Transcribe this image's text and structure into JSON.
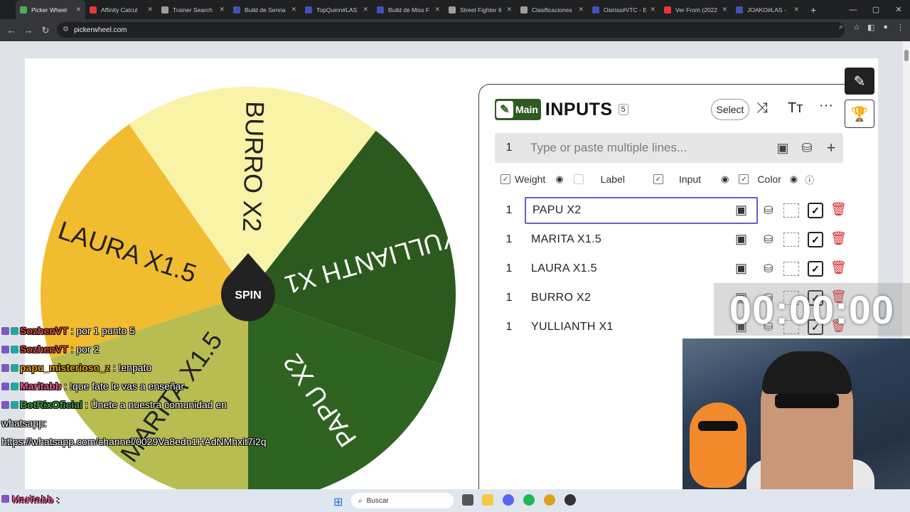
{
  "browser": {
    "tabs": [
      {
        "label": "Picker Wheel",
        "active": true,
        "color": "#4caf50"
      },
      {
        "label": "Affinity Calcul",
        "color": "#e53935"
      },
      {
        "label": "Trainer Search",
        "color": "#9e9e9e"
      },
      {
        "label": "Build de Senna",
        "color": "#3f51b5"
      },
      {
        "label": "TopQuinn#LAS",
        "color": "#3f51b5"
      },
      {
        "label": "Build de Miss F",
        "color": "#3f51b5"
      },
      {
        "label": "Street Fighter 6",
        "color": "#9e9e9e"
      },
      {
        "label": "Clasificaciones",
        "color": "#9e9e9e"
      },
      {
        "label": "Osiriss#VTC - E",
        "color": "#3f51b5"
      },
      {
        "label": "Ver From (2022",
        "color": "#e53935"
      },
      {
        "label": "JOAKO#LAS -",
        "color": "#3f51b5"
      }
    ],
    "url": "pickerwheel.com"
  },
  "wheel": {
    "spin_label": "SPIN",
    "segments": [
      {
        "label": "BURRO X2",
        "color": "#f8f3a6"
      },
      {
        "label": "YULLIANTH X1",
        "color": "#2c5a1e"
      },
      {
        "label": "PAPU X2",
        "color": "#2f6322"
      },
      {
        "label": "MARITA X1.5",
        "color": "#b8bd52"
      },
      {
        "label": "LAURA X1.5",
        "color": "#f1bc30"
      }
    ]
  },
  "inputs": {
    "badge": "Main",
    "title": "INPUTS",
    "count": "5",
    "select_label": "Select",
    "placeholder": "Type or paste multiple lines...",
    "add_weight": "1",
    "columns": {
      "weight": "Weight",
      "label": "Label",
      "input": "Input",
      "color": "Color"
    },
    "entries": [
      {
        "weight": "1",
        "text": "PAPU X2"
      },
      {
        "weight": "1",
        "text": "MARITA X1.5"
      },
      {
        "weight": "1",
        "text": "LAURA X1.5"
      },
      {
        "weight": "1",
        "text": "BURRO X2"
      },
      {
        "weight": "1",
        "text": "YULLIANTH X1"
      }
    ]
  },
  "overlay": {
    "timer": "00:00:00",
    "chat": [
      {
        "user": "SozhenVT",
        "msg": ": por 1 punto 5",
        "color": "#e04a3b"
      },
      {
        "user": "SozhenVT",
        "msg": ": por 2",
        "color": "#e04a3b"
      },
      {
        "user": "papu_misterioso_z",
        "msg": ": !enpato",
        "color": "#e8a317"
      },
      {
        "user": "Maritabb",
        "msg": ": !que fate le vas a enseñar",
        "color": "#f06292"
      },
      {
        "user": "BotRixOficial",
        "msg": ": Únete a nuestra comunidad en whatsapp: https://whatsapp.com/channel/0029Va8edn1HAdNMhxit7i2q",
        "color": "#43a047"
      }
    ],
    "last_chat_user": "Maritabb :"
  },
  "taskbar": {
    "search_placeholder": "Buscar"
  }
}
